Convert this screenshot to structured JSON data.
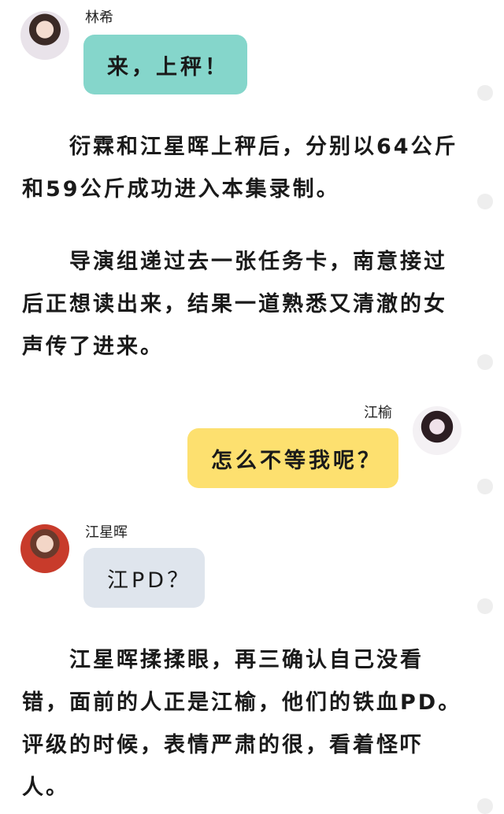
{
  "messages": [
    {
      "speaker": "林希",
      "text": "来，上秤！"
    },
    {
      "speaker": "江榆",
      "text": "怎么不等我呢？"
    },
    {
      "speaker": "江星晖",
      "text": "江PD？"
    }
  ],
  "paragraphs": [
    "衍霖和江星晖上秤后，分别以64公斤和59公斤成功进入本集录制。",
    "导演组递过去一张任务卡，南意接过后正想读出来，结果一道熟悉又清澈的女声传了进来。",
    "江星晖揉揉眼，再三确认自己没看错，面前的人正是江榆，他们的铁血PD。评级的时候，表情严肃的很，看着怪吓人。"
  ],
  "colors": {
    "teal": "#85d6cb",
    "yellow": "#fde06f",
    "grey": "#dfe5ed"
  }
}
